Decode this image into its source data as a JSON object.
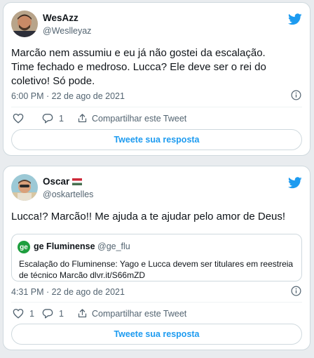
{
  "colors": {
    "accent": "#1d9bf0",
    "muted": "#536471",
    "text": "#0f1419",
    "border": "#cfd9de",
    "ge_green": "#1e9e3e"
  },
  "tweets": [
    {
      "name": "WesAzz",
      "handle": "@Weslleyaz",
      "body_lines": [
        "Marcão nem assumiu e eu já não gostei da escalação.",
        "Time fechado e medroso. Lucca? Ele deve ser o rei do",
        "coletivo! Só pode."
      ],
      "timestamp": "6:00 PM · 22 de ago de 2021",
      "likes": "",
      "replies": "1",
      "share_label": "Compartilhar este Tweet",
      "reply_button": "Tweete sua resposta"
    },
    {
      "name": "Oscar",
      "name_flag": "hungary-flag",
      "handle": "@oskartelles",
      "body_lines": [
        "Lucca!? Marcão!! Me ajuda a te ajudar pelo amor de Deus!"
      ],
      "quote": {
        "logo_text": "ge",
        "name": "ge Fluminense",
        "handle": "@ge_flu",
        "text_lines": [
          "Escalação do Fluminense: Yago e Lucca devem ser titulares em reestreia",
          "de técnico Marcão dlvr.it/S66mZD"
        ]
      },
      "timestamp": "4:31 PM · 22 de ago de 2021",
      "likes": "1",
      "replies": "1",
      "share_label": "Compartilhar este Tweet",
      "reply_button": "Tweete sua resposta"
    }
  ],
  "icons": {
    "brand": "twitter-bird-icon",
    "info": "info-icon",
    "like": "heart-icon",
    "reply": "reply-bubble-icon",
    "share": "share-arrow-icon"
  }
}
